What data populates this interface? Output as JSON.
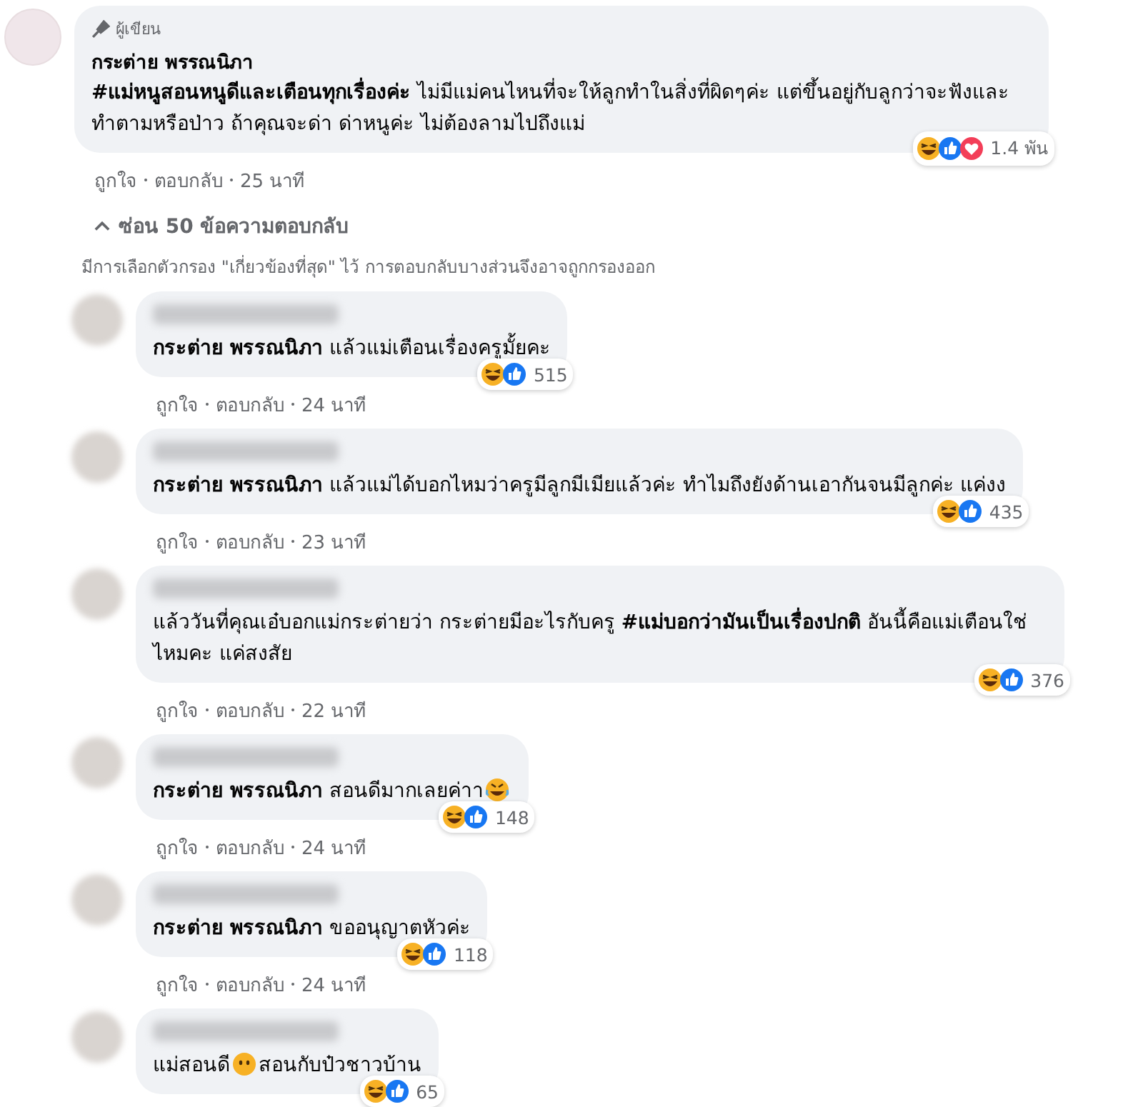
{
  "comment": {
    "badge": "ผู้เขียน",
    "author": "กระต่าย พรรณนิภา",
    "body": "**#แม่หนูสอนหนูดีและเตือนทุกเรื่องค่ะ** ไม่มีแม่คนไหนที่จะให้ลูกทำในสิ่งที่ผิดๆค่ะ แต่ขึ้นอยู่กับลูกว่าจะฟังและทำตามหรือป่าว ถ้าคุณจะด่า ด่าหนูค่ะ ไม่ต้องลามไปถึงแม่",
    "reactions": [
      {
        "kind": "haha"
      },
      {
        "kind": "like"
      },
      {
        "kind": "love"
      }
    ],
    "reaction_count": "1.4 พัน",
    "like": "ถูกใจ",
    "reply": "ตอบกลับ",
    "time": "25 นาที"
  },
  "hide_replies": "ซ่อน 50 ข้อความตอบกลับ",
  "filter_note": "มีการเลือกตัวกรอง \"เกี่ยวข้องที่สุด\" ไว้ การตอบกลับบางส่วนจึงอาจถูกกรองออก",
  "replies": [
    {
      "parts": [
        {
          "kind": "text",
          "text": "**กระต่าย พรรณนิภา** แล้วแม่เตือนเรื่องครูมั้ยคะ"
        }
      ],
      "reactions": [
        {
          "kind": "haha"
        },
        {
          "kind": "like"
        }
      ],
      "reaction_count": "515",
      "like": "ถูกใจ",
      "reply": "ตอบกลับ",
      "time": "24 นาที"
    },
    {
      "parts": [
        {
          "kind": "text",
          "text": "**กระต่าย พรรณนิภา** แล้วแม่ได้บอกไหมว่าครูมีลูกมีเมียแล้วค่ะ ทำไมถึงยังด้านเอากันจนมีลูกค่ะ แค่งง"
        }
      ],
      "reactions": [
        {
          "kind": "haha"
        },
        {
          "kind": "like"
        }
      ],
      "reaction_count": "435",
      "like": "ถูกใจ",
      "reply": "ตอบกลับ",
      "time": "23 นาที"
    },
    {
      "parts": [
        {
          "kind": "text",
          "text": "แล้ววันที่คุณเอ๋บอกแม่กระต่ายว่า กระต่ายมีอะไรกับครู **#แม่บอกว่ามันเป็นเรื่องปกติ** อันนี้คือแม่เตือนใช่ไหมคะ แค่สงสัย"
        }
      ],
      "reactions": [
        {
          "kind": "haha"
        },
        {
          "kind": "like"
        }
      ],
      "reaction_count": "376",
      "like": "ถูกใจ",
      "reply": "ตอบกลับ",
      "time": "22 นาที"
    },
    {
      "parts": [
        {
          "kind": "text",
          "text": "**กระต่าย พรรณนิภา** สอนดีมากเลยค่าา"
        },
        {
          "kind": "rofl"
        }
      ],
      "reactions": [
        {
          "kind": "haha"
        },
        {
          "kind": "like"
        }
      ],
      "reaction_count": "148",
      "like": "ถูกใจ",
      "reply": "ตอบกลับ",
      "time": "24 นาที"
    },
    {
      "parts": [
        {
          "kind": "text",
          "text": "**กระต่าย พรรณนิภา** ขออนุญาตหัวค่ะ"
        }
      ],
      "reactions": [
        {
          "kind": "haha"
        },
        {
          "kind": "like"
        }
      ],
      "reaction_count": "118",
      "like": "ถูกใจ",
      "reply": "ตอบกลับ",
      "time": "24 นาที"
    },
    {
      "parts": [
        {
          "kind": "text",
          "text": "แม่สอนดี"
        },
        {
          "kind": "mouthless"
        },
        {
          "kind": "text",
          "text": "สอนกับป๋วชาวบ้าน"
        }
      ],
      "reactions": [
        {
          "kind": "haha"
        },
        {
          "kind": "like"
        }
      ],
      "reaction_count": "65"
    }
  ]
}
